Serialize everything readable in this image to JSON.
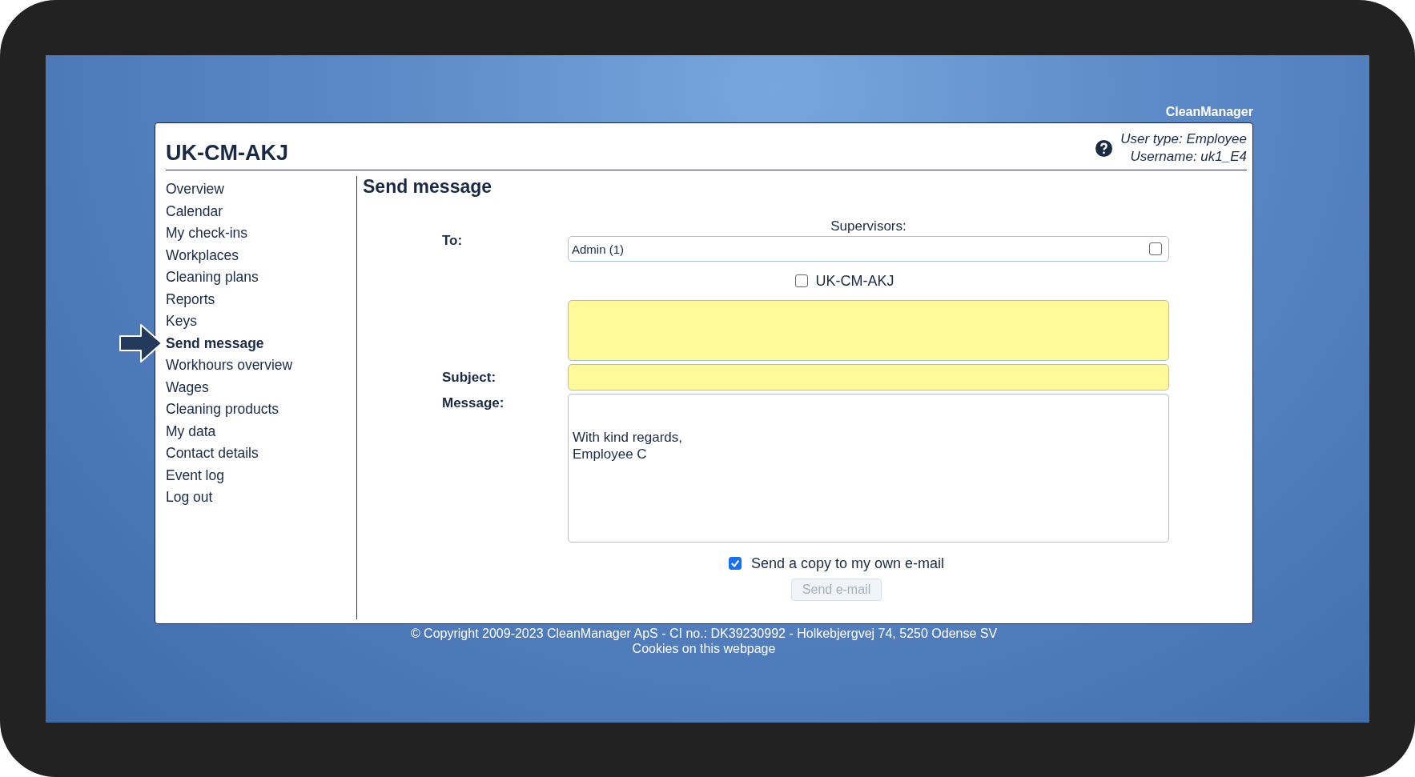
{
  "header": {
    "brand": "CleanManager",
    "title": "UK-CM-AKJ",
    "user_type": "User type: Employee",
    "username": "Username: uk1_E4"
  },
  "nav": [
    {
      "label": "Overview",
      "selected": false
    },
    {
      "label": "Calendar",
      "selected": false
    },
    {
      "label": "My check-ins",
      "selected": false
    },
    {
      "label": "Workplaces",
      "selected": false
    },
    {
      "label": "Cleaning plans",
      "selected": false
    },
    {
      "label": "Reports",
      "selected": false
    },
    {
      "label": "Keys",
      "selected": false
    },
    {
      "label": "Send message",
      "selected": true
    },
    {
      "label": "Workhours overview",
      "selected": false
    },
    {
      "label": "Wages",
      "selected": false
    },
    {
      "label": "Cleaning products",
      "selected": false
    },
    {
      "label": "My data",
      "selected": false
    },
    {
      "label": "Contact details",
      "selected": false
    },
    {
      "label": "Event log",
      "selected": false
    },
    {
      "label": "Log out",
      "selected": false
    }
  ],
  "form": {
    "heading": "Send message",
    "to_label": "To:",
    "supervisors_label": "Supervisors:",
    "recipients": [
      {
        "label": "Admin (1)",
        "checked": false
      }
    ],
    "group": {
      "label": "UK-CM-AKJ",
      "checked": false
    },
    "subject_label": "Subject:",
    "message_label": "Message:",
    "message": "With kind regards,\nEmployee C",
    "copy": {
      "label": "Send a copy to my own e-mail",
      "checked": true
    },
    "send_button": {
      "label": "Send e-mail",
      "disabled": true
    }
  },
  "footer": {
    "copyright": "© Copyright 2009-2023 CleanManager ApS - CI no.: DK39230992 - Holkebjergvej 74, 5250 Odense SV",
    "cookies": "Cookies on this webpage"
  }
}
